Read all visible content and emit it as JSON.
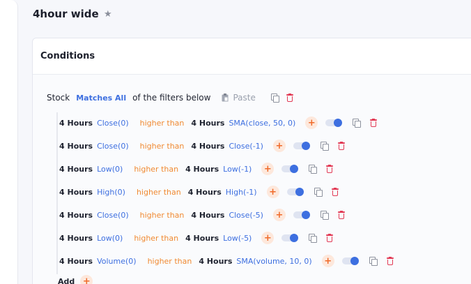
{
  "strategy": {
    "title": "4hour wide",
    "star_icon": "star-icon"
  },
  "conditions": {
    "header": "Conditions",
    "group": {
      "subject": "Stock",
      "mode": "Matches All",
      "suffix": "of the filters below",
      "paste_label": "Paste"
    },
    "rows": [
      {
        "timeframe": "4 Hours",
        "indicator": "Close(0)",
        "operator": "higher than",
        "timeframe2": "4 Hours",
        "indicator2": "SMA(close, 50, 0)",
        "enabled": true
      },
      {
        "timeframe": "4 Hours",
        "indicator": "Close(0)",
        "operator": "higher than",
        "timeframe2": "4 Hours",
        "indicator2": "Close(-1)",
        "enabled": true
      },
      {
        "timeframe": "4 Hours",
        "indicator": "Low(0)",
        "operator": "higher than",
        "timeframe2": "4 Hours",
        "indicator2": "Low(-1)",
        "enabled": true
      },
      {
        "timeframe": "4 Hours",
        "indicator": "High(0)",
        "operator": "higher than",
        "timeframe2": "4 Hours",
        "indicator2": "High(-1)",
        "enabled": true
      },
      {
        "timeframe": "4 Hours",
        "indicator": "Close(0)",
        "operator": "higher than",
        "timeframe2": "4 Hours",
        "indicator2": "Close(-5)",
        "enabled": true
      },
      {
        "timeframe": "4 Hours",
        "indicator": "Low(0)",
        "operator": "higher than",
        "timeframe2": "4 Hours",
        "indicator2": "Low(-5)",
        "enabled": true
      },
      {
        "timeframe": "4 Hours",
        "indicator": "Volume(0)",
        "operator": "higher than",
        "timeframe2": "4 Hours",
        "indicator2": "SMA(volume, 10, 0)",
        "enabled": true
      }
    ],
    "add_label": "Add"
  },
  "colors": {
    "accent_blue": "#3d6fe0",
    "operator_orange": "#f08a32",
    "delete_red": "#e23a55",
    "plus_bg": "#fde8dc"
  }
}
